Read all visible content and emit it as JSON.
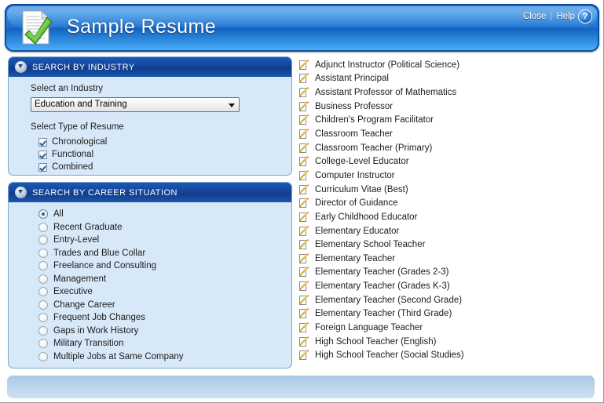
{
  "window": {
    "title": "Sample Resume",
    "logo_icon": "document-check-icon",
    "close_label": "Close",
    "separator": "|",
    "help_label": "Help",
    "help_icon": "question-mark-icon",
    "help_glyph": "?"
  },
  "colors": {
    "title_bar_blue": "#1463c0",
    "panel_header_blue": "#14459a",
    "panel_body_blue": "#d7e8f8",
    "panel_border": "#7ba7cf",
    "accent_check": "#2a62a8",
    "radio_dot": "#1f62ad",
    "bottom_bar": "#b9d3ec",
    "text": "#1b1b1b"
  },
  "industry_panel": {
    "collapse_icon": "circle-down-arrow-icon",
    "title": "SEARCH BY INDUSTRY",
    "select_label": "Select an Industry",
    "select_value": "Education and Training",
    "select_caret_icon": "chevron-down-icon",
    "resume_type_label": "Select Type of Resume",
    "checkboxes": [
      {
        "label": "Chronological",
        "checked": true
      },
      {
        "label": "Functional",
        "checked": true
      },
      {
        "label": "Combined",
        "checked": true
      }
    ]
  },
  "career_panel": {
    "collapse_icon": "circle-down-arrow-icon",
    "title": "SEARCH BY CAREER SITUATION",
    "options": [
      {
        "label": "All",
        "selected": true
      },
      {
        "label": "Recent Graduate",
        "selected": false
      },
      {
        "label": "Entry-Level",
        "selected": false
      },
      {
        "label": "Trades and Blue Collar",
        "selected": false
      },
      {
        "label": "Freelance and Consulting",
        "selected": false
      },
      {
        "label": "Management",
        "selected": false
      },
      {
        "label": "Executive",
        "selected": false
      },
      {
        "label": "Change Career",
        "selected": false
      },
      {
        "label": "Frequent Job Changes",
        "selected": false
      },
      {
        "label": "Gaps in Work History",
        "selected": false
      },
      {
        "label": "Military Transition",
        "selected": false
      },
      {
        "label": "Multiple Jobs at Same Company",
        "selected": false
      }
    ]
  },
  "resume_list": {
    "item_icon": "document-pencil-edit-icon",
    "items": [
      "Adjunct Instructor (Political Science)",
      "Assistant Principal",
      "Assistant Professor of Mathematics",
      "Business Professor",
      "Children's Program Facilitator",
      "Classroom Teacher",
      "Classroom Teacher (Primary)",
      "College-Level Educator",
      "Computer Instructor",
      "Curriculum Vitae (Best)",
      "Director of Guidance",
      "Early Childhood Educator",
      "Elementary Educator",
      "Elementary School Teacher",
      "Elementary Teacher",
      "Elementary Teacher (Grades 2-3)",
      "Elementary Teacher (Grades K-3)",
      "Elementary Teacher (Second Grade)",
      "Elementary Teacher (Third Grade)",
      "Foreign Language Teacher",
      "High School Teacher (English)",
      "High School Teacher (Social Studies)"
    ]
  }
}
